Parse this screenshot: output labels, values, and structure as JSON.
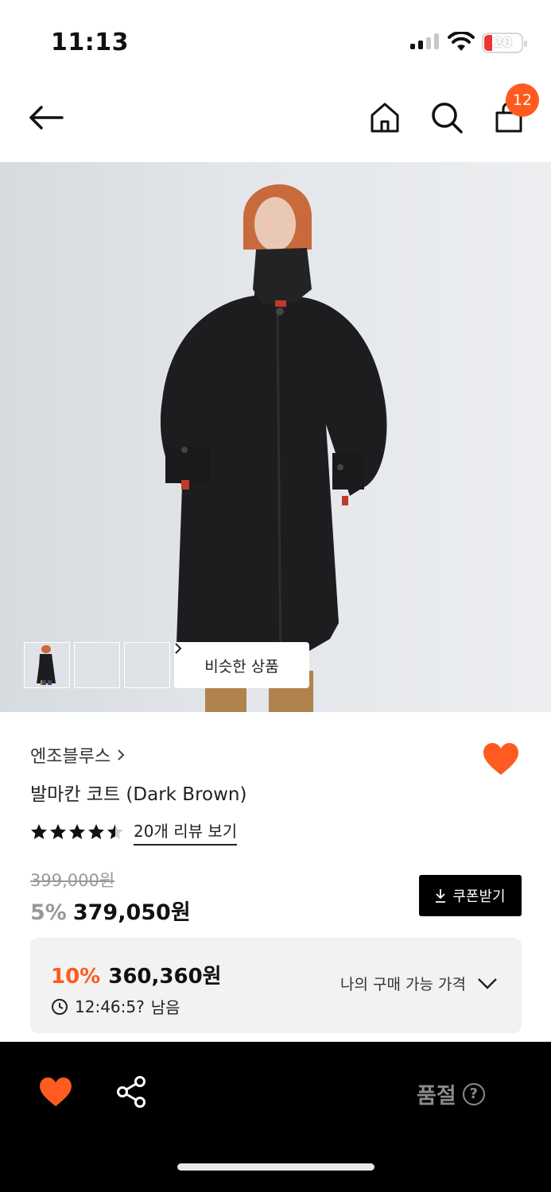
{
  "status_bar": {
    "time": "11:13",
    "battery_level": "20",
    "icons": [
      "cellular-signal-icon",
      "wifi-icon",
      "battery-icon"
    ]
  },
  "nav": {
    "icons": [
      "back-arrow-icon",
      "home-icon",
      "search-icon",
      "shopping-bag-icon"
    ],
    "cart_count": "12"
  },
  "gallery": {
    "thumbnail_count": 3,
    "similar_label": "비슷한 상품"
  },
  "product": {
    "brand": "엔조블루스",
    "title": "발마칸 코트 (Dark Brown)",
    "rating": 4.5,
    "rating_max": 5,
    "review_link": "20개 리뷰 보기",
    "original_price": "399,000원",
    "discount_rate": "5%",
    "sale_price": "379,050원",
    "coupon_label": "쿠폰받기",
    "wishlisted": true
  },
  "best_price": {
    "rate": "10%",
    "price": "360,360원",
    "timer": "12:46:5?",
    "timer_suffix": "남음",
    "toggle_label": "나의 구매 가능 가격"
  },
  "bottom_bar": {
    "status": "품절",
    "help": "?"
  },
  "colors": {
    "accent": "#ff5a1f",
    "bottom_bar": "#000000",
    "muted_text": "#999999"
  }
}
